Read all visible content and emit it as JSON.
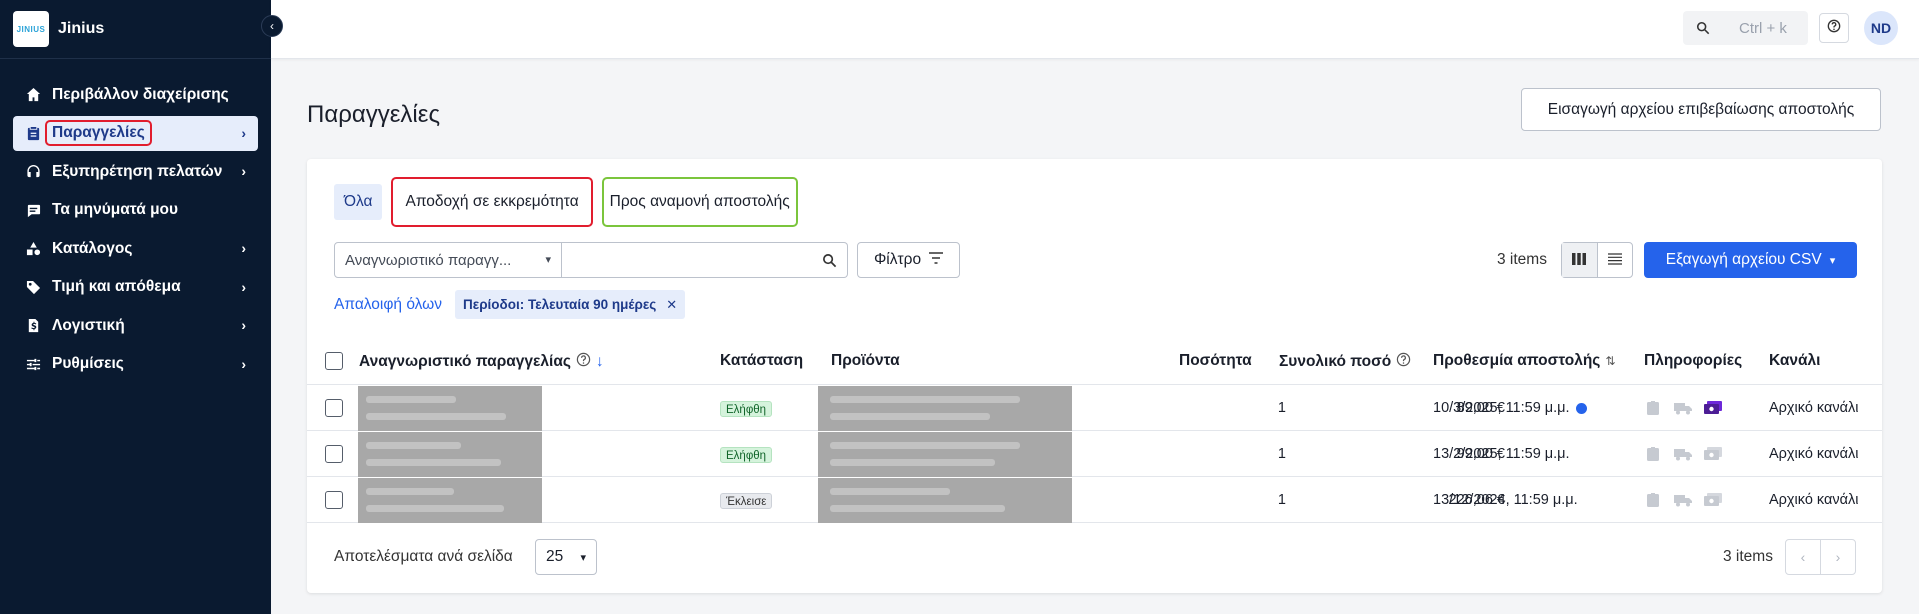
{
  "app": {
    "logo_text": "JINIUS",
    "name": "Jinius"
  },
  "sidebar": {
    "items": [
      {
        "label": "Περιβάλλον διαχείρισης",
        "icon": "home-icon",
        "has_chevron": false
      },
      {
        "label": "Παραγγελίες",
        "icon": "clipboard-icon",
        "has_chevron": true,
        "active": true
      },
      {
        "label": "Εξυπηρέτηση πελατών",
        "icon": "headset-icon",
        "has_chevron": true
      },
      {
        "label": "Τα μηνύματά μου",
        "icon": "message-icon",
        "has_chevron": false
      },
      {
        "label": "Κατάλογος",
        "icon": "shapes-icon",
        "has_chevron": true
      },
      {
        "label": "Τιμή και απόθεμα",
        "icon": "tag-icon",
        "has_chevron": true
      },
      {
        "label": "Λογιστική",
        "icon": "document-dollar-icon",
        "has_chevron": true
      },
      {
        "label": "Ρυθμίσεις",
        "icon": "sliders-icon",
        "has_chevron": true
      }
    ]
  },
  "topbar": {
    "search_placeholder": "Ctrl + k",
    "avatar_initials": "ND"
  },
  "page": {
    "title": "Παραγγελίες",
    "import_button": "Εισαγωγή αρχείου επιβεβαίωσης αποστολής"
  },
  "tabs": [
    "Όλα",
    "Αποδοχή σε εκκρεμότητα",
    "Προς αναμονή αποστολής"
  ],
  "filters": {
    "id_select": "Αναγνωριστικό παραγγ...",
    "filter_button": "Φίλτρο",
    "items_count": "3 items",
    "export_button": "Εξαγωγή αρχείου CSV",
    "clear_all": "Απαλοιφή όλων",
    "chip": "Περίοδοι: Τελευταία 90 ημέρες"
  },
  "table": {
    "headers": {
      "order_id": "Αναγνωριστικό παραγγελίας",
      "status": "Κατάσταση",
      "products": "Προϊόντα",
      "quantity": "Ποσότητα",
      "total": "Συνολικό ποσό",
      "deadline": "Προθεσμία αποστολής",
      "info": "Πληροφορίες",
      "channel": "Κανάλι"
    },
    "rows": [
      {
        "status": "Ελήφθη",
        "quantity": "1",
        "total": "89,00 €",
        "deadline": "10/3/2025, 11:59 μ.μ.",
        "channel": "Αρχικό κανάλι"
      },
      {
        "status": "Ελήφθη",
        "quantity": "1",
        "total": "99,00 €",
        "deadline": "13/2/2025, 11:59 μ.μ.",
        "channel": "Αρχικό κανάλι"
      },
      {
        "status": "Έκλεισε",
        "quantity": "1",
        "total": "226,06 €",
        "deadline": "13/12/2024, 11:59 μ.μ.",
        "channel": "Αρχικό κανάλι"
      }
    ]
  },
  "footer": {
    "per_page_label": "Αποτελέσματα ανά σελίδα",
    "per_page_value": "25",
    "items_count": "3 items"
  },
  "colors": {
    "sidebar_bg": "#0a1a30",
    "accent": "#2563eb",
    "highlight_red": "#e11d2e",
    "highlight_green": "#7bc53c"
  }
}
